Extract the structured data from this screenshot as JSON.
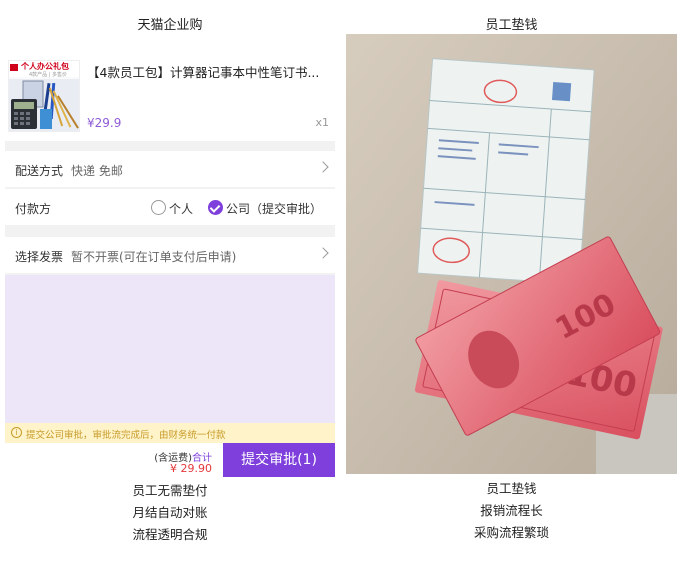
{
  "left_column": {
    "title": "天猫企业购",
    "product": {
      "thumb_title": "个人办公礼包",
      "thumb_subtitle": "4款产品 | 多售价",
      "name": "【4款员工包】计算器记事本中性笔订书...",
      "price": "¥29.9",
      "quantity": "x1"
    },
    "delivery": {
      "label": "配送方式",
      "value": "快递 免邮"
    },
    "payment": {
      "label": "付款方",
      "options": [
        {
          "label": "个人",
          "selected": false
        },
        {
          "label": "公司（提交审批）",
          "selected": true
        }
      ]
    },
    "invoice": {
      "label": "选择发票",
      "value": "暂不开票(可在订单支付后申请)"
    },
    "notice": "提交公司审批，审批流完成后，由财务统一付款",
    "bottom_bar": {
      "freight_note": "(含运费)",
      "total_label": "合计",
      "total_price": "¥ 29.90",
      "submit_label": "提交审批(1)"
    },
    "captions": [
      "员工无需垫付",
      "月结自动对账",
      "流程透明合规"
    ]
  },
  "right_column": {
    "title": "员工垫钱",
    "photo_alt": "发票与百元人民币",
    "captions": [
      "员工垫钱",
      "报销流程长",
      "采购流程繁琐"
    ]
  },
  "colors": {
    "accent": "#7e3fdc",
    "price_purple": "#8e5bd6",
    "price_red": "#e4393c",
    "notice_bg": "#fff4c9",
    "notice_text": "#c89b2b"
  },
  "icons": {
    "selected_radio": "check-circle-icon",
    "unselected_radio": "circle-icon",
    "row_arrow": "chevron-right-icon",
    "notice": "info-icon"
  }
}
